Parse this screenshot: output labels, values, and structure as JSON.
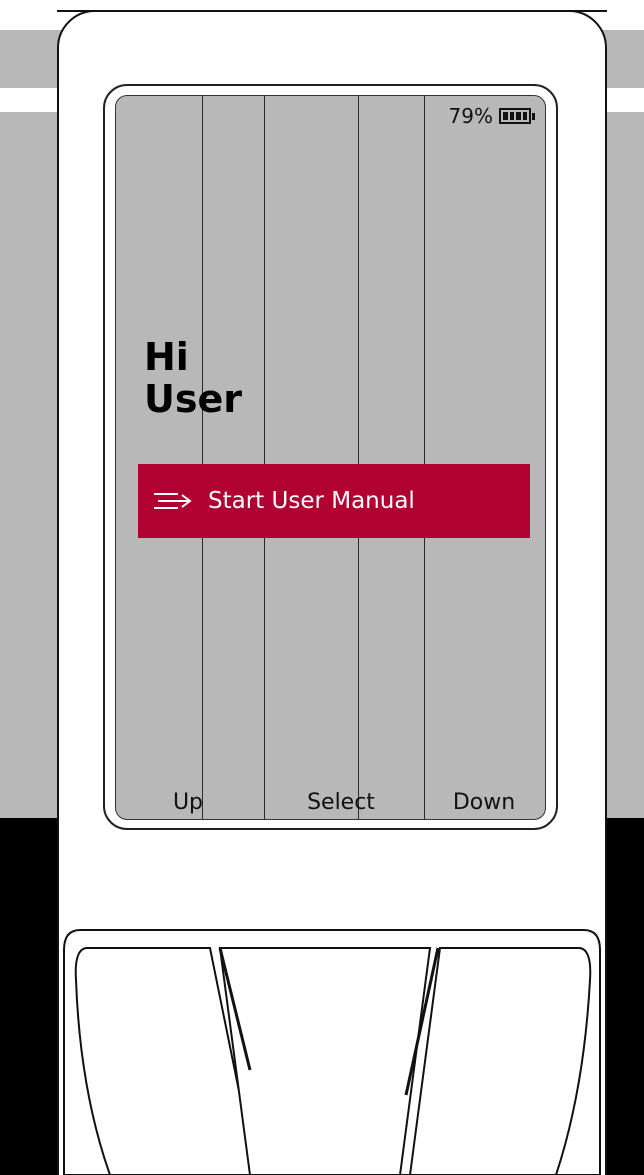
{
  "status": {
    "battery_percent": "79%",
    "battery_level": 0.79,
    "battery_icon": "battery-icon"
  },
  "greeting": {
    "line1": "Hi",
    "line2": "User"
  },
  "start_button": {
    "label": "Start User Manual",
    "icon": "arrow-lines-icon"
  },
  "softkeys": {
    "up": "Up",
    "select": "Select",
    "down": "Down"
  },
  "colors": {
    "screen_background": "#b8b8b8",
    "accent": "#b10032",
    "device": "#ffffff",
    "outline": "#111111"
  }
}
